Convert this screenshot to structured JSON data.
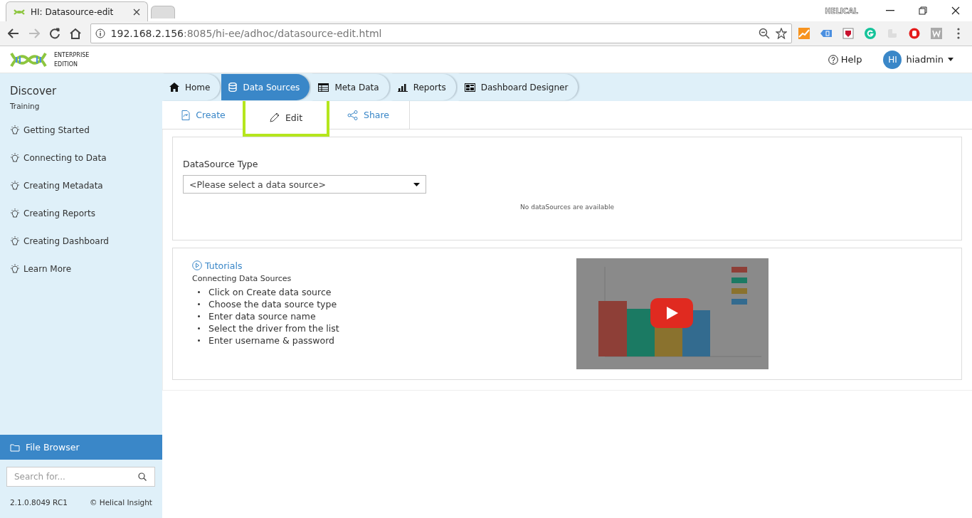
{
  "browser": {
    "tab": {
      "title": "HI: Datasource-edit"
    },
    "profile": "HELICAL",
    "url": {
      "host": "192.168.2.156",
      "path": ":8085/hi-ee/adhoc/datasource-edit.html"
    }
  },
  "header": {
    "logo_lines": [
      "ENTERPRISE",
      "EDITION"
    ],
    "help": "Help",
    "user": {
      "initials": "HI",
      "name": "hiadmin"
    }
  },
  "nav": [
    {
      "label": "Home",
      "selected": false
    },
    {
      "label": "Data Sources",
      "selected": true
    },
    {
      "label": "Meta Data",
      "selected": false
    },
    {
      "label": "Reports",
      "selected": false
    },
    {
      "label": "Dashboard Designer",
      "selected": false
    }
  ],
  "sidebar": {
    "title": "Discover",
    "subtitle": "Training",
    "items": [
      "Getting Started",
      "Connecting to Data",
      "Creating Metadata",
      "Creating Reports",
      "Creating Dashboard",
      "Learn More"
    ],
    "file_browser": "File Browser",
    "search": {
      "placeholder": "Search for..."
    },
    "version": "2.1.0.8049 RC1",
    "copyright": "© Helical Insight"
  },
  "subtabs": [
    {
      "label": "Create",
      "selected": false
    },
    {
      "label": "Edit",
      "selected": true
    },
    {
      "label": "Share",
      "selected": false
    }
  ],
  "form": {
    "label": "DataSource Type",
    "select": "<Please select a data source>",
    "message": "No dataSources are available"
  },
  "tutorials": {
    "title": "Tutorials",
    "subtitle": "Connecting Data Sources",
    "steps": [
      "Click on Create data source",
      "Choose the data source type",
      "Enter data source name",
      "Select the driver from the list",
      "Enter username & password"
    ],
    "video": {
      "kind": "picture"
    }
  }
}
